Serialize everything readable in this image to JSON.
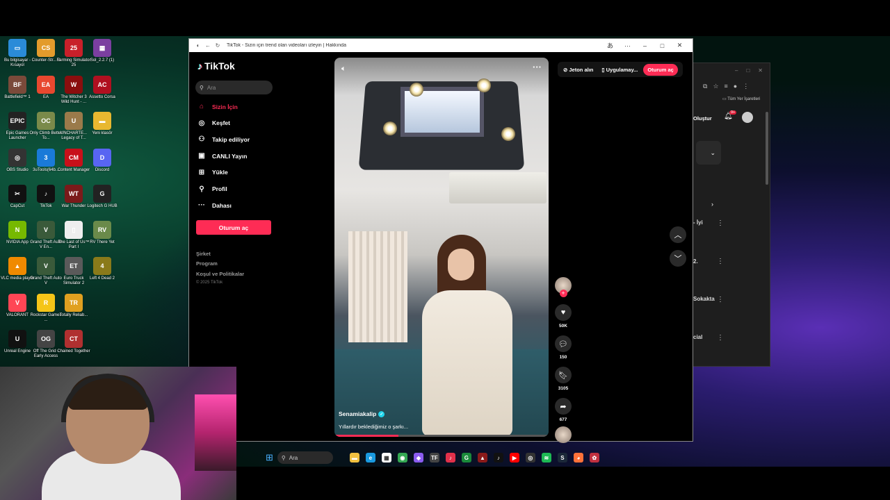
{
  "desktop": {
    "icons": [
      {
        "label": "Bu bilgisayar - Kısayol",
        "color": "#2a8bd8",
        "glyph": "▭"
      },
      {
        "label": "Counter-Str... 2",
        "color": "#e39b2c",
        "glyph": "CS"
      },
      {
        "label": "Farming Simulator 25",
        "color": "#c8202a",
        "glyph": "25"
      },
      {
        "label": "Sol_2.2.7 (1)",
        "color": "#7b3fa0",
        "glyph": "▦"
      },
      {
        "label": "Battlefield™ 1",
        "color": "#7a4a3a",
        "glyph": "BF"
      },
      {
        "label": "EA",
        "color": "#e8482f",
        "glyph": "EA"
      },
      {
        "label": "The Witcher 3 Wild Hunt - ...",
        "color": "#8a0e0e",
        "glyph": "W"
      },
      {
        "label": "Assetto Corsa",
        "color": "#b01020",
        "glyph": "AC"
      },
      {
        "label": "Epic Games Launcher",
        "color": "#222222",
        "glyph": "EPIC"
      },
      {
        "label": "Only Climb Better To...",
        "color": "#7a8a4a",
        "glyph": "OC"
      },
      {
        "label": "UNCHARTE... Legacy of T...",
        "color": "#9a7a4a",
        "glyph": "U"
      },
      {
        "label": "Yeni klasör",
        "color": "#e8b830",
        "glyph": "▬"
      },
      {
        "label": "OBS Studio",
        "color": "#333333",
        "glyph": "◎"
      },
      {
        "label": "3uTools(64b...",
        "color": "#1a7ad8",
        "glyph": "3"
      },
      {
        "label": "Content Manager",
        "color": "#c8101a",
        "glyph": "CM"
      },
      {
        "label": "Discord",
        "color": "#5865f2",
        "glyph": "D"
      },
      {
        "label": "CapCut",
        "color": "#111111",
        "glyph": "✂"
      },
      {
        "label": "TikTok",
        "color": "#111111",
        "glyph": "♪"
      },
      {
        "label": "War Thunder",
        "color": "#7a1a1a",
        "glyph": "WT"
      },
      {
        "label": "Logitech G HUB",
        "color": "#222222",
        "glyph": "G"
      },
      {
        "label": "NVIDIA App",
        "color": "#76b900",
        "glyph": "N"
      },
      {
        "label": "Grand Theft Auto V En...",
        "color": "#3a5a3a",
        "glyph": "V"
      },
      {
        "label": "The Last of Us™ Part I",
        "color": "#eeeeee",
        "glyph": "▯"
      },
      {
        "label": "RV There Yet",
        "color": "#6a8a4a",
        "glyph": "RV"
      },
      {
        "label": "VLC media player",
        "color": "#f08a00",
        "glyph": "▲"
      },
      {
        "label": "Grand Theft Auto V",
        "color": "#3a5a3a",
        "glyph": "V"
      },
      {
        "label": "Euro Truck Simulator 2",
        "color": "#5a5a5a",
        "glyph": "ET"
      },
      {
        "label": "Left 4 Dead 2",
        "color": "#8a7a1a",
        "glyph": "4"
      },
      {
        "label": "VALORANT",
        "color": "#ff4655",
        "glyph": "V"
      },
      {
        "label": "Rockstar Games ...",
        "color": "#f5c518",
        "glyph": "R"
      },
      {
        "label": "Totally Reliab...",
        "color": "#e0a020",
        "glyph": "TR"
      },
      {
        "label": "Unreal Engine",
        "color": "#111111",
        "glyph": "U"
      },
      {
        "label": "Off The Grid - Early Access",
        "color": "#444444",
        "glyph": "OG"
      },
      {
        "label": "Chained Together",
        "color": "#b03030",
        "glyph": "CT"
      }
    ]
  },
  "bg_browser": {
    "create_label": "Oluştur",
    "bookmarks_label": "Tüm Yer İşaretleri",
    "notif_count": "9+",
    "rows": [
      "- İyi",
      "2.",
      "Sokakta",
      "cial"
    ]
  },
  "tiktok_window": {
    "title": "TikTok - Sizin için trend olan videoları izleyin | Hakkında",
    "controls": [
      "–",
      "□",
      "✕"
    ]
  },
  "tiktok": {
    "logo": "TikTok",
    "search_placeholder": "Ara",
    "nav": [
      {
        "label": "Sizin İçin",
        "icon": "home-icon",
        "glyph": "⌂",
        "active": true
      },
      {
        "label": "Keşfet",
        "icon": "compass-icon",
        "glyph": "◎",
        "active": false
      },
      {
        "label": "Takip ediliyor",
        "icon": "following-icon",
        "glyph": "⚇",
        "active": false
      },
      {
        "label": "CANLI Yayın",
        "icon": "live-icon",
        "glyph": "▣",
        "active": false
      },
      {
        "label": "Yükle",
        "icon": "upload-icon",
        "glyph": "⊞",
        "active": false
      },
      {
        "label": "Profil",
        "icon": "profile-icon",
        "glyph": "⚲",
        "active": false
      },
      {
        "label": "Dahası",
        "icon": "more-icon",
        "glyph": "···",
        "active": false
      }
    ],
    "login_button": "Oturum aç",
    "footer_links": [
      "Şirket",
      "Program",
      "Koşul ve Politikalar"
    ],
    "copyright": "© 2025 TikTok",
    "top_actions": {
      "coins": "Jeton alın",
      "app": "Uygulamay...",
      "login": "Oturum aç"
    },
    "video": {
      "author": "Senamiakalip",
      "caption": "Yıllardır beklediğimiz o şarkı...",
      "progress_percent": 30
    },
    "counts": {
      "likes": "50K",
      "comments": "150",
      "saves": "3105",
      "shares": "677"
    }
  },
  "taskbar": {
    "search_placeholder": "Ara",
    "apps": [
      {
        "name": "file-explorer",
        "color": "#f0c040",
        "glyph": "▬"
      },
      {
        "name": "edge",
        "color": "#1a9ae0",
        "glyph": "e"
      },
      {
        "name": "store",
        "color": "#ffffff",
        "glyph": "▦"
      },
      {
        "name": "chrome",
        "color": "#34a853",
        "glyph": "◉"
      },
      {
        "name": "app-purple",
        "color": "#8a5cf0",
        "glyph": "◆"
      },
      {
        "name": "app-tf",
        "color": "#444444",
        "glyph": "TF"
      },
      {
        "name": "app-red",
        "color": "#e0304a",
        "glyph": "♪"
      },
      {
        "name": "app-green",
        "color": "#1a8a3a",
        "glyph": "G"
      },
      {
        "name": "app-darkred",
        "color": "#8a1a1a",
        "glyph": "▲"
      },
      {
        "name": "tiktok",
        "color": "#111111",
        "glyph": "♪"
      },
      {
        "name": "youtube",
        "color": "#ff0000",
        "glyph": "▶"
      },
      {
        "name": "obs",
        "color": "#333333",
        "glyph": "◎"
      },
      {
        "name": "spotify",
        "color": "#1db954",
        "glyph": "≋"
      },
      {
        "name": "steam",
        "color": "#1b2838",
        "glyph": "S"
      },
      {
        "name": "firefox",
        "color": "#ff7139",
        "glyph": "◕"
      },
      {
        "name": "app-misc",
        "color": "#c03040",
        "glyph": "✿"
      }
    ]
  },
  "colors": {
    "tiktok_accent": "#fe2c55",
    "verified": "#20d5ec"
  }
}
